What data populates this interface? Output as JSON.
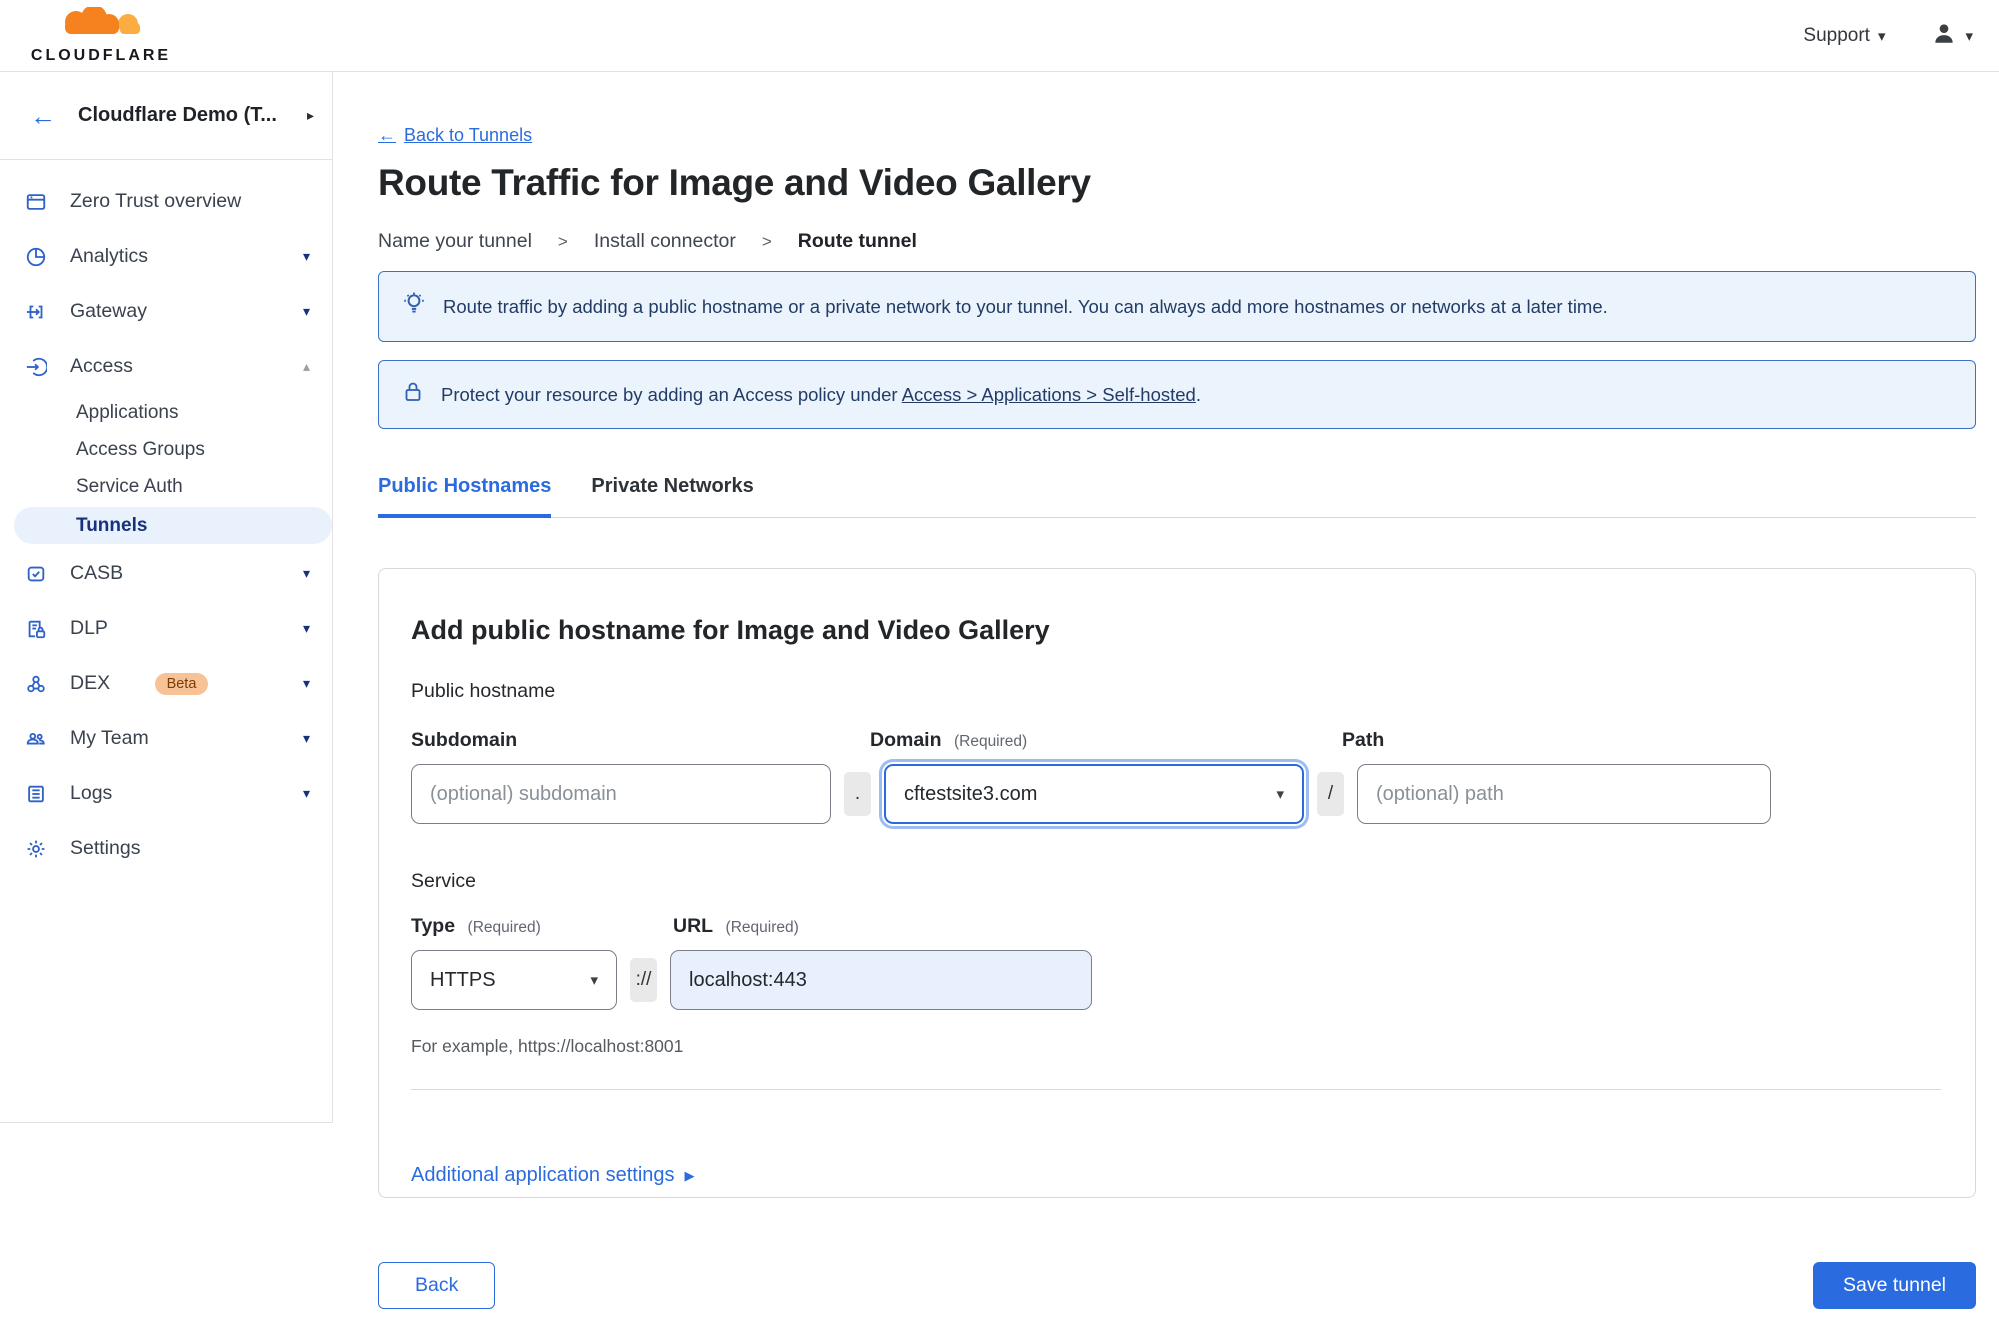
{
  "topbar": {
    "brand": "CLOUDFLARE",
    "support_label": "Support",
    "caret": "▾"
  },
  "sidebar": {
    "account_label": "Cloudflare Demo (T...",
    "back_arrow": "←",
    "expand_arrow": "▸",
    "caret_down": "▾",
    "caret_up": "▴",
    "items": {
      "overview": "Zero Trust overview",
      "analytics": "Analytics",
      "gateway": "Gateway",
      "access": "Access",
      "applications": "Applications",
      "access_groups": "Access Groups",
      "service_auth": "Service Auth",
      "tunnels": "Tunnels",
      "casb": "CASB",
      "dlp": "DLP",
      "dex": "DEX",
      "dex_badge": "Beta",
      "my_team": "My Team",
      "logs": "Logs",
      "settings": "Settings"
    }
  },
  "main": {
    "back_link": {
      "arrow": "←",
      "label": "Back to Tunnels"
    },
    "title": "Route Traffic for Image and Video Gallery",
    "steps": {
      "s1": "Name your tunnel",
      "s2": "Install connector",
      "s3": "Route tunnel",
      "separator": ">"
    },
    "banner_info": "Route traffic by adding a public hostname or a private network to your tunnel. You can always add more hostnames or networks at a later time.",
    "banner_access": {
      "prefix": "Protect your resource by adding an Access policy under",
      "link": "Access > Applications > Self-hosted",
      "suffix": "."
    },
    "tabs": {
      "public": "Public Hostnames",
      "private": "Private Networks"
    },
    "card": {
      "heading": "Add public hostname for Image and Video Gallery",
      "public_hostname_label": "Public hostname",
      "subdomain_label": "Subdomain",
      "domain_label": "Domain",
      "required_label": "(Required)",
      "path_label": "Path",
      "subdomain_placeholder": "(optional) subdomain",
      "dot_separator": ".",
      "domain_value": "cftestsite3.com",
      "slash_separator": "/",
      "path_placeholder": "(optional) path",
      "service_label": "Service",
      "type_label": "Type",
      "type_value": "HTTPS",
      "scheme_separator": "://",
      "url_label": "URL",
      "url_value": "localhost:443",
      "select_caret": "▾",
      "example_hint": "For example, https://localhost:8001",
      "additional_settings_label": "Additional application settings",
      "expand_glyph": "▶"
    },
    "footer": {
      "back_label": "Back",
      "save_label": "Save tunnel"
    }
  },
  "colors": {
    "accent_blue": "#2b6be0",
    "banner_border": "#3a70c8",
    "banner_bg": "#ebf3fc",
    "selected_item_bg": "#e9f2fc",
    "sidebar_icon_blue": "#2f62c9",
    "logo_orange": "#f6821f",
    "logo_orange_light": "#fbad41",
    "url_input_bg": "#e8f0fd"
  }
}
